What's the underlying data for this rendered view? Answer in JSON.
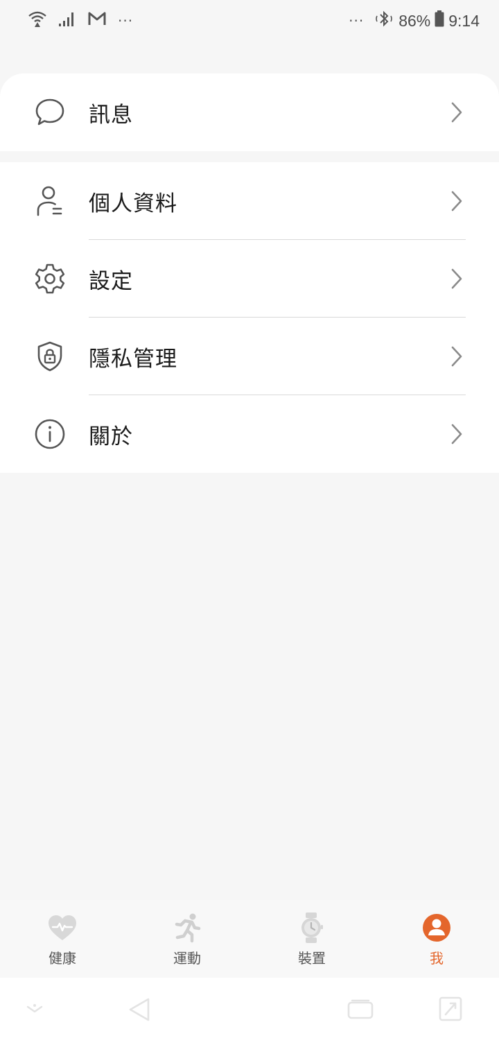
{
  "status_bar": {
    "left_icons": [
      "wifi-icon",
      "signal-icon",
      "gmail-icon"
    ],
    "left_more": "···",
    "right_more": "···",
    "battery_percent": "86%",
    "time": "9:14"
  },
  "menu_top": {
    "items": [
      {
        "label": "訊息",
        "icon": "message-icon"
      }
    ]
  },
  "menu_list": {
    "items": [
      {
        "label": "個人資料",
        "icon": "profile-icon"
      },
      {
        "label": "設定",
        "icon": "gear-icon"
      },
      {
        "label": "隱私管理",
        "icon": "shield-lock-icon"
      },
      {
        "label": "關於",
        "icon": "info-icon"
      }
    ]
  },
  "tabbar": {
    "tabs": [
      {
        "label": "健康",
        "icon": "heart-pulse-icon",
        "active": false
      },
      {
        "label": "運動",
        "icon": "running-icon",
        "active": false
      },
      {
        "label": "裝置",
        "icon": "watch-icon",
        "active": false
      },
      {
        "label": "我",
        "icon": "person-icon",
        "active": true
      }
    ]
  },
  "colors": {
    "accent": "#e4662c",
    "background": "#f6f6f6",
    "card": "#ffffff",
    "text": "#1a1a1a",
    "icon_gray": "#555555"
  }
}
